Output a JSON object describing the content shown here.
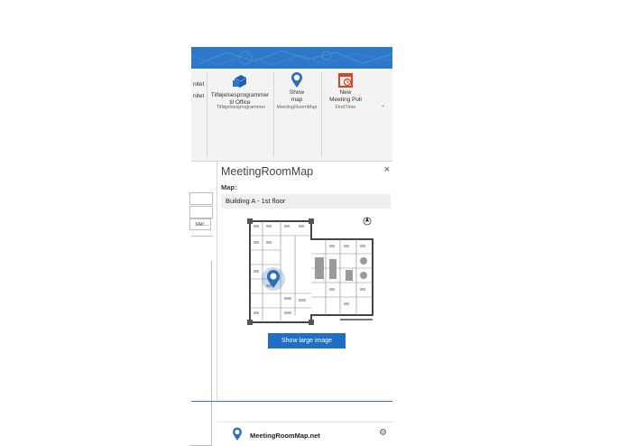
{
  "ribbon": {
    "cut_labels": [
      "nitet",
      "nitet"
    ],
    "addins_button": {
      "line1": "Tilføjelsesprogrammer",
      "line2": "til Office",
      "icon": "office-addins-icon"
    },
    "addins_group": "Tilføjelsesprogrammer",
    "show_map_button": {
      "line1": "Show",
      "line2": "map",
      "icon": "map-pin-icon"
    },
    "show_map_group": "MeetingRoomMap",
    "poll_button": {
      "line1": "New",
      "line2": "Meeting Poll",
      "icon": "calendar-poll-icon"
    },
    "poll_group": "FindTime",
    "collapse_glyph": "⌃"
  },
  "left_pane": {
    "button_fragment": "ster..."
  },
  "panel": {
    "title": "MeetingRoomMap",
    "close_glyph": "×",
    "map_label": "Map:",
    "building_value": "Building A - 1st floor",
    "large_image_button": "Show large image",
    "footer_name": "MeetingRoomMap.net",
    "gear_glyph": "⚙"
  },
  "colors": {
    "title_blue": "#2b79c7",
    "button_blue": "#1f6fc6",
    "pin_blue": "#2e6fb8",
    "poll_red": "#e0421f"
  }
}
